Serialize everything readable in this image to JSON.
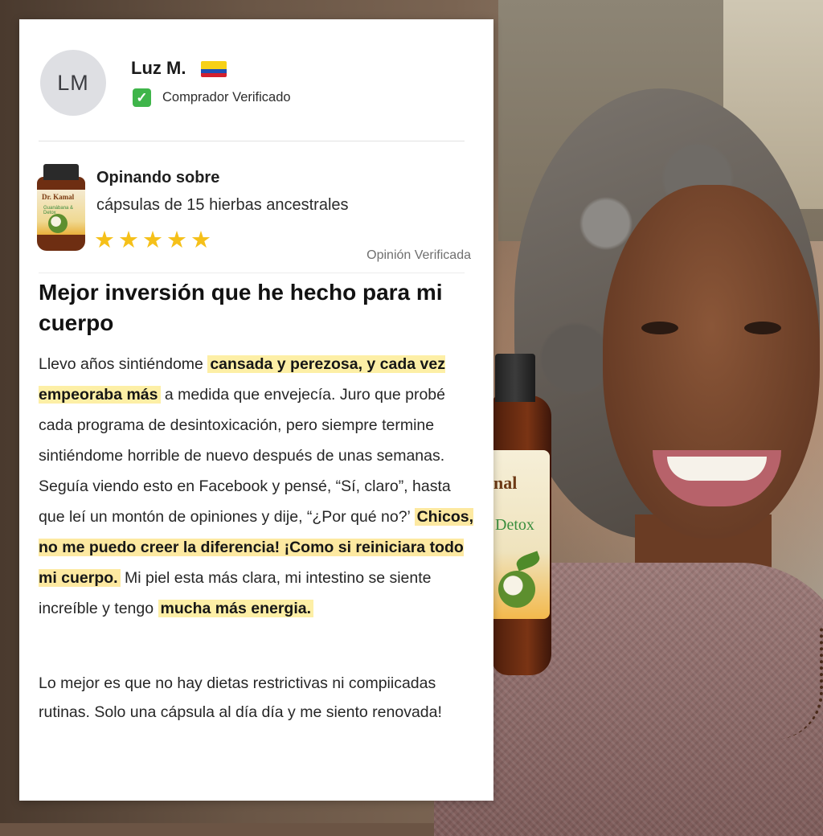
{
  "reviewer": {
    "initials": "LM",
    "name": "Luz M.",
    "badge": "Comprador Verificado"
  },
  "product": {
    "heading": "Opinando sobre",
    "name": "cápsulas de 15 hierbas ancestrales",
    "rating": 5,
    "rating_stars": [
      "★",
      "★",
      "★",
      "★",
      "★"
    ],
    "thumb_brand": "Dr. Kamal",
    "thumb_subtitle": "Guanábana & Detox"
  },
  "review": {
    "verified_label": "Opinión Verificada",
    "title": "Mejor inversión que he hecho para mi cuerpo",
    "p1_a": "Llevo años sintiéndome ",
    "p1_hl1": "cansada y perezosa, y cada vez empeoraba más",
    "p1_b": " a medida que envejecía. Juro que probé cada programa de desintoxicación, pero siempre termine sintiéndome horrible de nuevo después de unas semanas. Seguía viendo esto en Facebook y pensé, “Sí, claro”, hasta que leí un montón de opiniones y dije, “¿Por qué no?’ ",
    "p1_hl2": "Chicos, no me puedo creer la diferencia! ¡Como si reiniciara todo mi cuerpo.",
    "p1_c": " Mi piel esta más clara, mi intestino se siente increíble y tengo ",
    "p1_hl3": "mucha más energia.",
    "p2": "Lo mejor es que no hay dietas restrictivas ni compiicadas rutinas. Solo una cápsula al día día y me siento renovada!"
  },
  "bottle": {
    "brand_fragment": "nal",
    "product_fragment": "Detox"
  },
  "colors": {
    "star": "#f5c019",
    "highlight": "#fdefa6",
    "verified_check": "#3fb54a"
  }
}
